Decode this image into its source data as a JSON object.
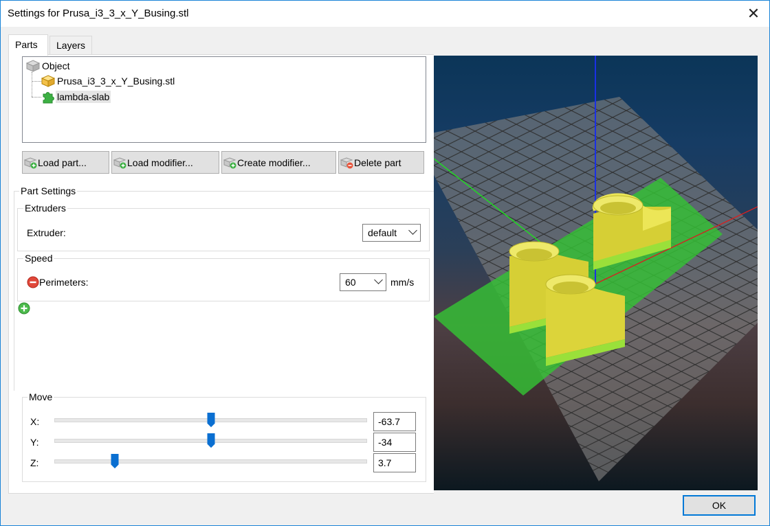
{
  "window": {
    "title": "Settings for Prusa_i3_3_x_Y_Busing.stl",
    "close_glyph": "✕"
  },
  "tabs": [
    {
      "label": "Parts"
    },
    {
      "label": "Layers"
    }
  ],
  "tree": {
    "root": "Object",
    "children": [
      "Prusa_i3_3_x_Y_Busing.stl",
      "lambda-slab"
    ]
  },
  "buttons": {
    "load_part": "Load part...",
    "load_modifier": "Load modifier...",
    "create_modifier": "Create modifier...",
    "delete_part": "Delete part",
    "ok": "OK"
  },
  "part_settings": {
    "title": "Part Settings",
    "extruders": {
      "title": "Extruders",
      "label": "Extruder:",
      "value": "default"
    },
    "speed": {
      "title": "Speed",
      "label": "Perimeters:",
      "value": "60",
      "unit": "mm/s"
    }
  },
  "move": {
    "title": "Move",
    "x": {
      "label": "X:",
      "value": "-63.7",
      "level": 0.5
    },
    "y": {
      "label": "Y:",
      "value": "-34",
      "level": 0.5
    },
    "z": {
      "label": "Z:",
      "value": "3.7",
      "level": 0.19
    }
  },
  "colors": {
    "accent": "#0078d7",
    "part": "#e8e24a",
    "slab": "#2fbf2f",
    "bed": "#6a6a6a"
  }
}
